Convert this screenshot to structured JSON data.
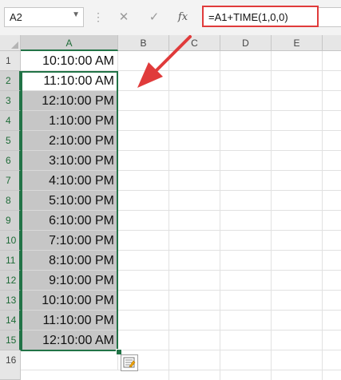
{
  "formula_bar": {
    "name_box": "A2",
    "dots": "⋮",
    "cancel_glyph": "✕",
    "enter_glyph": "✓",
    "fx_label": "fx",
    "formula": "=A1+TIME(1,0,0)"
  },
  "columns": [
    "A",
    "B",
    "C",
    "D",
    "E"
  ],
  "rows": [
    {
      "num": "1",
      "value": "10:10:00 AM"
    },
    {
      "num": "2",
      "value": "11:10:00 AM"
    },
    {
      "num": "3",
      "value": "12:10:00 PM"
    },
    {
      "num": "4",
      "value": "1:10:00 PM"
    },
    {
      "num": "5",
      "value": "2:10:00 PM"
    },
    {
      "num": "6",
      "value": "3:10:00 PM"
    },
    {
      "num": "7",
      "value": "4:10:00 PM"
    },
    {
      "num": "8",
      "value": "5:10:00 PM"
    },
    {
      "num": "9",
      "value": "6:10:00 PM"
    },
    {
      "num": "10",
      "value": "7:10:00 PM"
    },
    {
      "num": "11",
      "value": "8:10:00 PM"
    },
    {
      "num": "12",
      "value": "9:10:00 PM"
    },
    {
      "num": "13",
      "value": "10:10:00 PM"
    },
    {
      "num": "14",
      "value": "11:10:00 PM"
    },
    {
      "num": "15",
      "value": "12:10:00 AM"
    },
    {
      "num": "16",
      "value": ""
    }
  ],
  "colors": {
    "selection": "#217346",
    "annotation": "#e03b3b",
    "shade": "#c6c6c6"
  },
  "icons": {
    "autofill": "autofill-options-icon",
    "annotation_arrow": "red-arrow-icon"
  }
}
